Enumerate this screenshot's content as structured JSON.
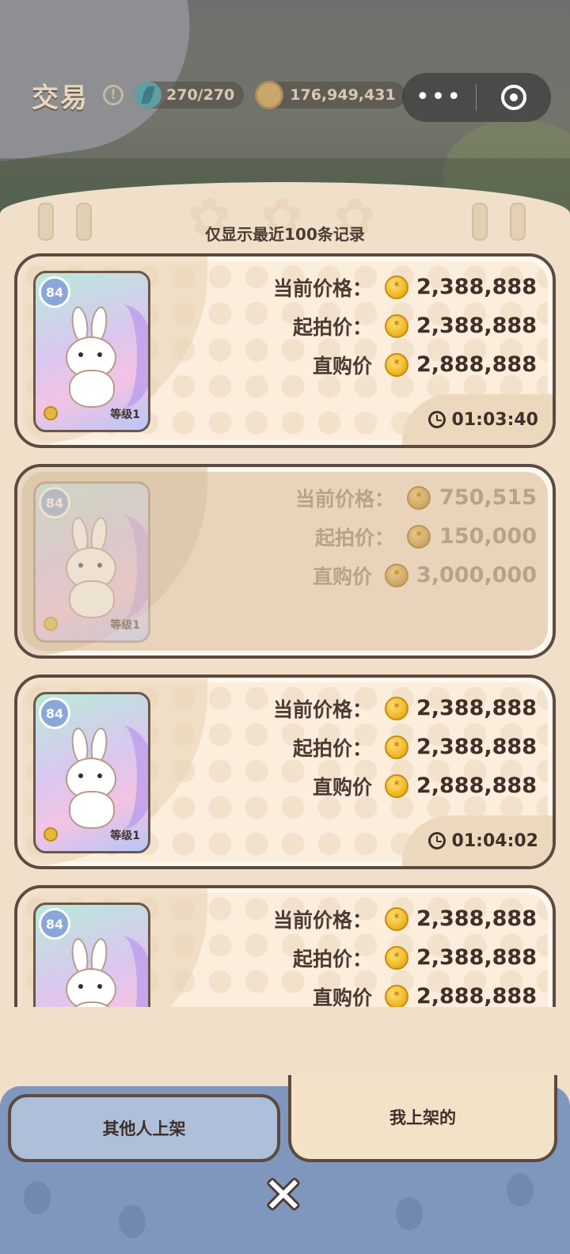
{
  "header": {
    "title": "交易",
    "help_icon": "help-icon",
    "energy": "270/270",
    "coins": "176,949,431"
  },
  "capsule": {
    "more_label": "•••",
    "target_icon": "target-icon"
  },
  "notice": "仅显示最近100条记录",
  "labels": {
    "current": "当前价格：",
    "start": "起拍价：",
    "buyout": "直购价"
  },
  "listings": [
    {
      "level_badge": "84",
      "grade": "等级1",
      "current": "2,388,888",
      "start": "2,388,888",
      "buyout": "2,888,888",
      "timer": "01:03:40",
      "state": "active"
    },
    {
      "level_badge": "84",
      "grade": "等级1",
      "current": "750,515",
      "start": "150,000",
      "buyout": "3,000,000",
      "timer": "",
      "state": "dimmed"
    },
    {
      "level_badge": "84",
      "grade": "等级1",
      "current": "2,388,888",
      "start": "2,388,888",
      "buyout": "2,888,888",
      "timer": "01:04:02",
      "state": "active"
    },
    {
      "level_badge": "84",
      "grade": "",
      "current": "2,388,888",
      "start": "2,388,888",
      "buyout": "2,888,888",
      "timer": "",
      "state": "active"
    }
  ],
  "tabs": {
    "other": "其他人上架",
    "mine": "我上架的",
    "selected": "mine"
  },
  "close": "✕"
}
